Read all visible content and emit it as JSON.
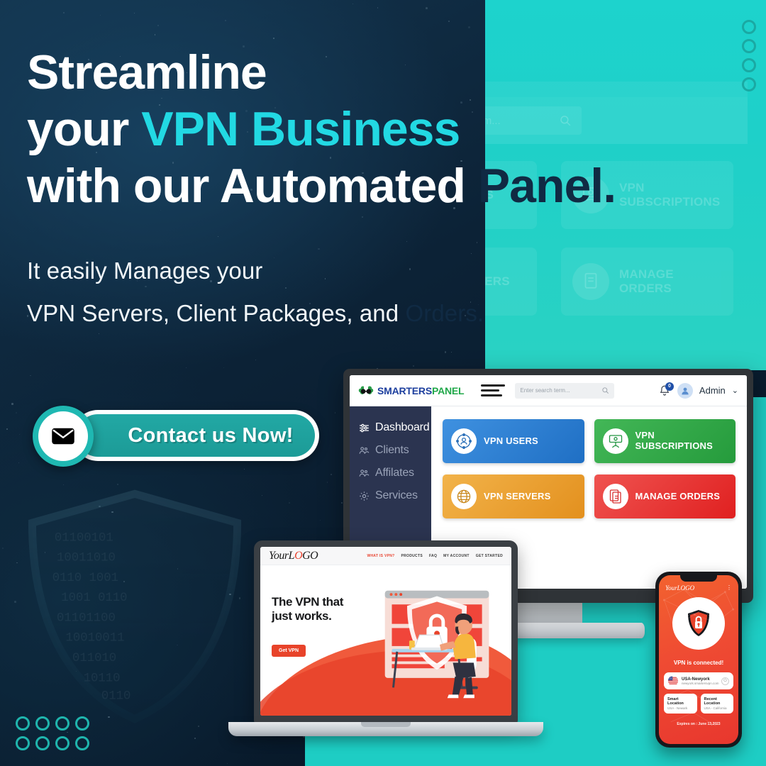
{
  "hero": {
    "headline_line1": "Streamline",
    "headline_line2_plain": "your ",
    "headline_line2_accent": "VPN Business",
    "headline_line3_plain": "with our Automated ",
    "headline_line3_dark": "Panel.",
    "subhead_line1": "It easily Manages your",
    "subhead_line2_plain": "VPN Servers, Client Packages, and ",
    "subhead_line2_dark": "Orders."
  },
  "cta": {
    "label": "Contact us Now!",
    "icon": "envelope-icon"
  },
  "colors": {
    "accent_cyan": "#22d9e3",
    "teal_slab": "#1dd3cd",
    "dark_navy": "#102a43",
    "cta_teal": "#1c9b97",
    "card_blue": "#2a7fd4",
    "card_green": "#2eaa44",
    "card_orange": "#eda02e",
    "card_red": "#e53935"
  },
  "decor": {
    "rings_top_right_count": 4,
    "rings_bottom_left_count": 8,
    "watermark": "binary-shield"
  },
  "monitor": {
    "brand": {
      "name_primary": "SMARTERS",
      "name_secondary": "PANEL",
      "icon": "brain-glasses-icon"
    },
    "search": {
      "placeholder": "Enter search term...",
      "value": "",
      "icon": "search-icon"
    },
    "notifications": {
      "count": "0",
      "icon": "bell-icon"
    },
    "account": {
      "label": "Admin",
      "avatar_icon": "user-avatar-icon",
      "chevron": "⌄"
    },
    "menu_icon": "hamburger-icon",
    "sidebar": [
      {
        "label": "Dashboard",
        "icon": "sliders-icon",
        "active": true
      },
      {
        "label": "Clients",
        "icon": "users-icon",
        "active": false
      },
      {
        "label": "Affilates",
        "icon": "users-icon",
        "active": false
      },
      {
        "label": "Services",
        "icon": "gear-icon",
        "active": false
      }
    ],
    "cards": [
      {
        "label": "VPN USERS",
        "color": "#2a7fd4",
        "icon": "network-user-icon"
      },
      {
        "label": "VPN SUBSCRIPTIONS",
        "color": "#2eaa44",
        "icon": "money-hand-icon"
      },
      {
        "label": "VPN SERVERS",
        "color": "#eda02e",
        "icon": "globe-server-icon"
      },
      {
        "label": "MANAGE ORDERS",
        "color": "#e53935",
        "icon": "documents-icon"
      }
    ]
  },
  "ghost_panel": {
    "search_placeholder": "Enter search term...",
    "cards": [
      {
        "label": "VPN USERS"
      },
      {
        "label": "VPN SUBSCRIPTIONS"
      },
      {
        "label": "VPN SERVERS"
      },
      {
        "label": "MANAGE ORDERS"
      }
    ]
  },
  "laptop": {
    "logo_pre": "Your",
    "logo_l": "L",
    "logo_o": "O",
    "logo_go": "GO",
    "nav": [
      "WHAT IS VPN?",
      "PRODUCTS",
      "FAQ",
      "MY ACCOUNT",
      "GET STARTED"
    ],
    "headline_line1": "The VPN that",
    "headline_line2": "just works.",
    "button": "Get VPN",
    "illustration": "person-laptop-shield-lock-illustration"
  },
  "phone": {
    "logo": "YourLOGO",
    "menu_icon": "kebab-menu-icon",
    "shield_icon": "shield-lock-icon",
    "status": "VPN is connected!",
    "server": {
      "flag": "us-flag-icon",
      "name": "USA-Newyork",
      "url": "newyork.smartersvpn.com",
      "action_icon": "power-icon"
    },
    "locations": [
      {
        "title": "Smart Location",
        "value": "USA - Newark"
      },
      {
        "title": "Recent Location",
        "value": "USA - California"
      }
    ],
    "expiry": "Expires on : June 13,2023"
  }
}
